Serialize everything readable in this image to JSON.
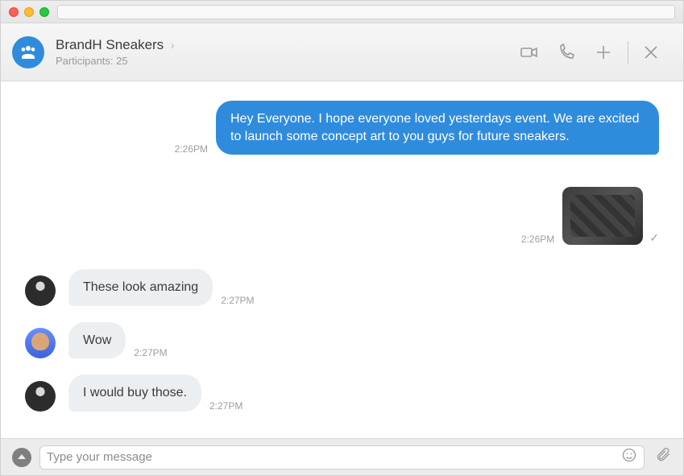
{
  "header": {
    "chat_name": "BrandH Sneakers",
    "participants_label": "Participants:",
    "participants_count": "25"
  },
  "messages": {
    "m0": {
      "text": "Hey Everyone. I hope everyone loved yesterdays event. We are excited to launch some concept art to you guys for future sneakers.",
      "ts": "2:26PM"
    },
    "m1": {
      "ts": "2:26PM"
    },
    "m2": {
      "text": "These look amazing",
      "ts": "2:27PM"
    },
    "m3": {
      "text": "Wow",
      "ts": "2:27PM"
    },
    "m4": {
      "text": "I would buy those.",
      "ts": "2:27PM"
    }
  },
  "composer": {
    "placeholder": "Type your message"
  }
}
